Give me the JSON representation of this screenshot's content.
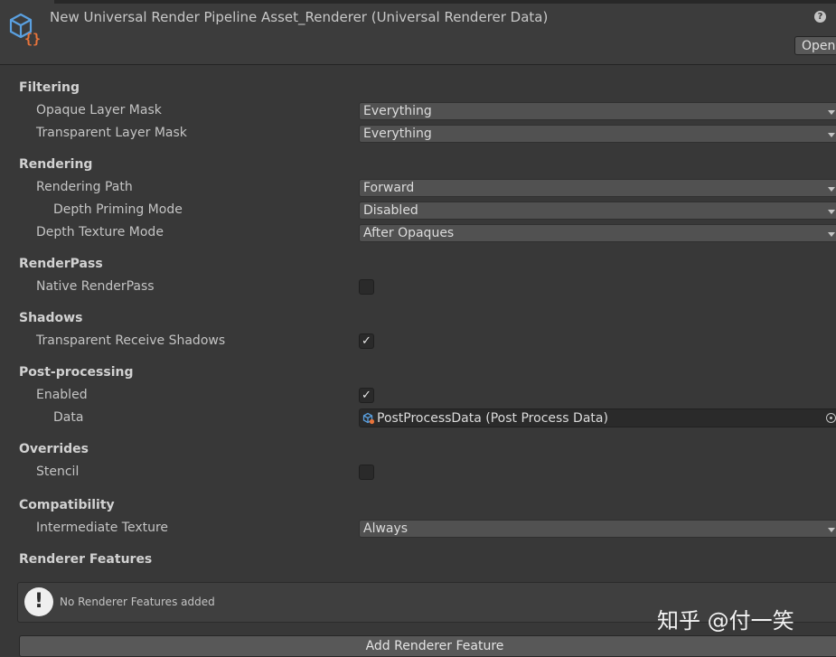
{
  "header": {
    "title": "New Universal Render Pipeline Asset_Renderer (Universal Renderer Data)",
    "help_glyph": "?",
    "open_label": "Open",
    "asset_icon": "scriptable-object-icon"
  },
  "sections": {
    "filtering": "Filtering",
    "rendering": "Rendering",
    "renderpass": "RenderPass",
    "shadows": "Shadows",
    "postprocessing": "Post-processing",
    "overrides": "Overrides",
    "compatibility": "Compatibility",
    "renderer_features": "Renderer Features"
  },
  "fields": {
    "opaque_layer_mask": {
      "label": "Opaque Layer Mask",
      "value": "Everything"
    },
    "transparent_layer_mask": {
      "label": "Transparent Layer Mask",
      "value": "Everything"
    },
    "rendering_path": {
      "label": "Rendering Path",
      "value": "Forward"
    },
    "depth_priming_mode": {
      "label": "Depth Priming Mode",
      "value": "Disabled"
    },
    "depth_texture_mode": {
      "label": "Depth Texture Mode",
      "value": "After Opaques"
    },
    "native_renderpass": {
      "label": "Native RenderPass",
      "checked": false
    },
    "transparent_receive_shadows": {
      "label": "Transparent Receive Shadows",
      "checked": true
    },
    "pp_enabled": {
      "label": "Enabled",
      "checked": true
    },
    "pp_data": {
      "label": "Data",
      "value": "PostProcessData (Post Process Data)"
    },
    "stencil": {
      "label": "Stencil",
      "checked": false
    },
    "intermediate_texture": {
      "label": "Intermediate Texture",
      "value": "Always"
    }
  },
  "renderer_features": {
    "empty_message": "No Renderer Features added",
    "add_button": "Add Renderer Feature",
    "warning_glyph": "!"
  },
  "check_glyph": "✓",
  "watermark": "知乎 @付一笑",
  "colors": {
    "background": "#383838",
    "header": "#3c3c3c",
    "dropdown": "#515151",
    "field_dark": "#2a2a2a",
    "icon_blue": "#5aa0e0",
    "icon_orange": "#e8743b"
  }
}
